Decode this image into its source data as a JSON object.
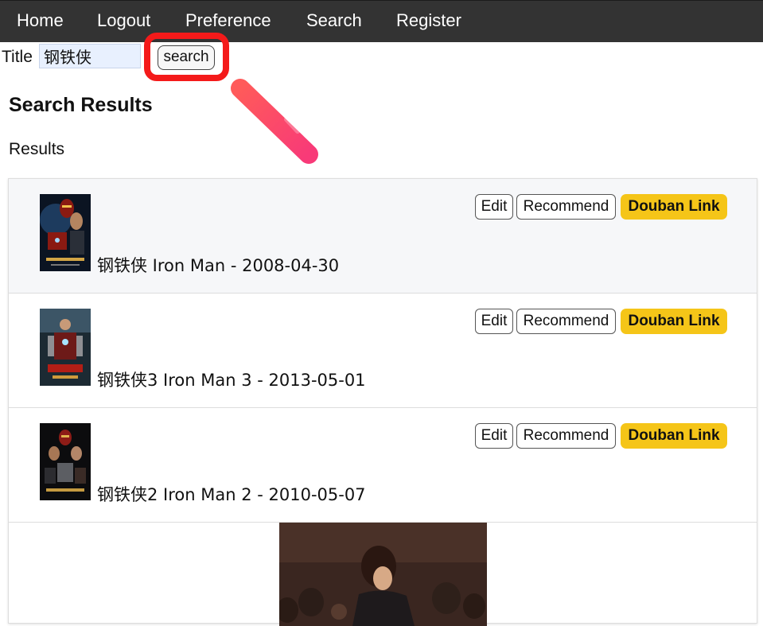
{
  "nav": {
    "items": [
      "Home",
      "Logout",
      "Preference",
      "Search",
      "Register"
    ]
  },
  "search": {
    "label": "Title",
    "value": "钢铁侠",
    "button": "search"
  },
  "heading": "Search Results",
  "subheading": "Results",
  "results": [
    {
      "text": "钢铁侠 Iron Man - 2008-04-30",
      "edit": "Edit",
      "recommend": "Recommend",
      "douban": "Douban Link"
    },
    {
      "text": "钢铁侠3 Iron Man 3 - 2013-05-01",
      "edit": "Edit",
      "recommend": "Recommend",
      "douban": "Douban Link"
    },
    {
      "text": "钢铁侠2 Iron Man 2 - 2010-05-07",
      "edit": "Edit",
      "recommend": "Recommend",
      "douban": "Douban Link"
    }
  ],
  "colors": {
    "navbar": "#333333",
    "highlight": "#f41a1a",
    "douban_button": "#f5c518",
    "active_row": "#f6f7f9"
  }
}
